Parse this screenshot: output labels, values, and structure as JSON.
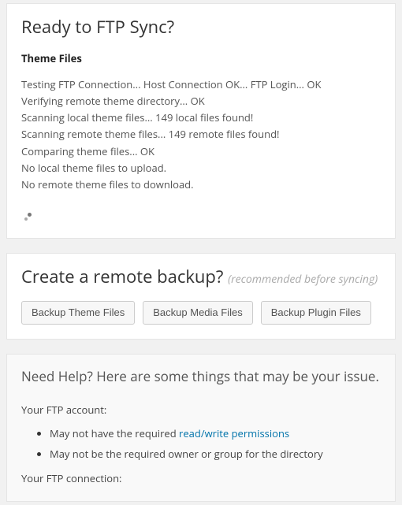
{
  "sync": {
    "title": "Ready to FTP Sync?",
    "subheading": "Theme Files",
    "lines": [
      "Testing FTP Connection... Host Connection OK... FTP Login... OK",
      "Verifying remote theme directory... OK",
      "Scanning local theme files... 149 local files found!",
      "Scanning remote theme files... 149 remote files found!",
      "Comparing theme files... OK",
      "No local theme files to upload.",
      "No remote theme files to download."
    ]
  },
  "backup": {
    "title": "Create a remote backup?",
    "hint": "(recommended before syncing)",
    "buttons": {
      "theme": "Backup Theme Files",
      "media": "Backup Media Files",
      "plugin": "Backup Plugin Files"
    }
  },
  "help": {
    "title": "Need Help? Here are some things that may be your issue.",
    "account_label": "Your FTP account:",
    "item1_prefix": "May not have the required ",
    "item1_link": "read/write permissions",
    "item2": "May not be the required owner or group for the directory",
    "connection_label": "Your FTP connection:"
  }
}
